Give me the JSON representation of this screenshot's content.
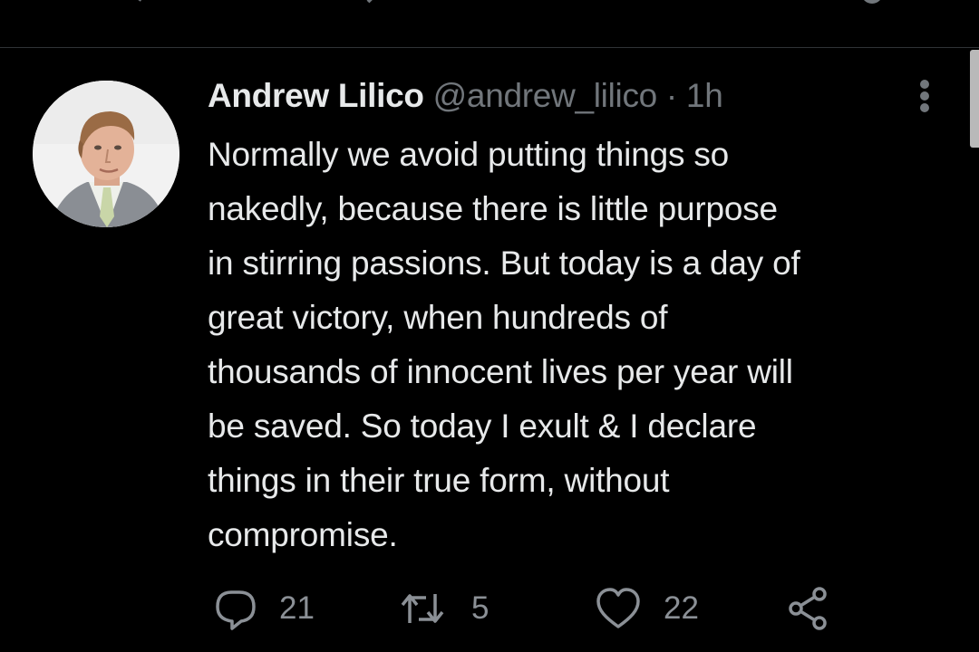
{
  "previous_tweet": {
    "actions": [
      {
        "icon": "reply-icon"
      },
      {
        "icon": "retweet-icon"
      },
      {
        "icon": "like-icon"
      },
      {
        "icon": "share-icon"
      }
    ]
  },
  "tweet": {
    "author": {
      "display_name": "Andrew Lilico",
      "handle": "@andrew_lilico",
      "avatar_icon": "avatar-photo"
    },
    "separator": "·",
    "time": "1h",
    "more_icon": "more-vertical-icon",
    "text_lines": [
      "Normally we avoid putting things so",
      "nakedly, because there is little purpose",
      "in stirring passions. But today is a day of",
      "great victory, when hundreds of",
      "thousands of innocent lives per year will",
      "be saved. So today I exult & I declare",
      "things in their true form, without",
      "compromise."
    ],
    "actions": {
      "reply": {
        "icon": "reply-icon",
        "count": "21"
      },
      "retweet": {
        "icon": "retweet-icon",
        "count": "5"
      },
      "like": {
        "icon": "like-icon",
        "count": "22"
      },
      "share": {
        "icon": "share-icon"
      }
    }
  },
  "colors": {
    "background": "#000000",
    "primary_text": "#e7e9ea",
    "secondary_text": "#71767b",
    "divider": "#2f3336"
  }
}
